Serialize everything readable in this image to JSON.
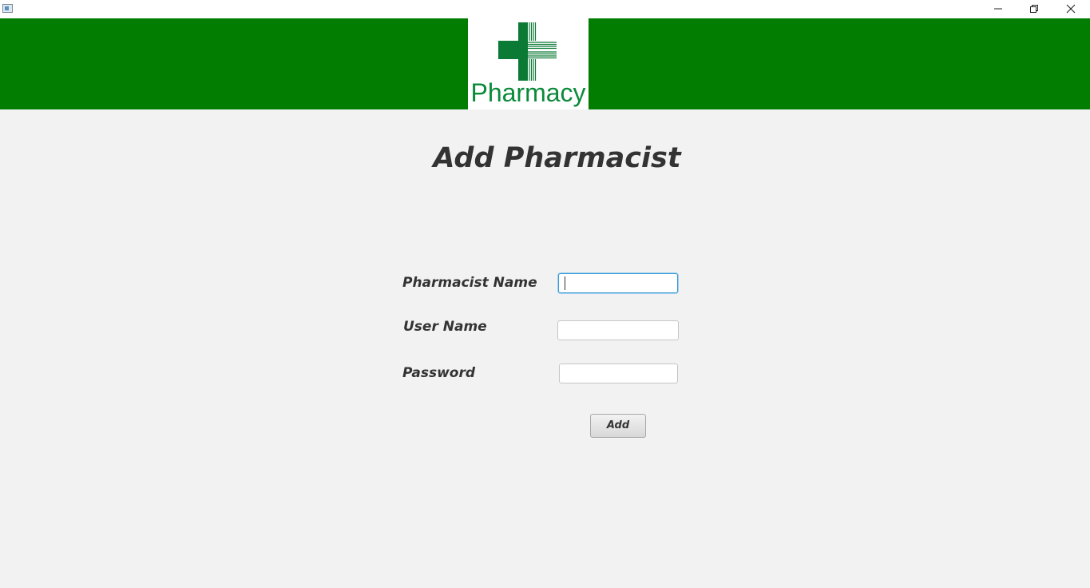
{
  "window": {
    "icons": [
      "app-icon",
      "minimize-icon",
      "restore-icon",
      "close-icon"
    ]
  },
  "header": {
    "background_color": "#027d02",
    "logo": {
      "text": "Pharmacy",
      "icon": "pharmacy-cross-icon",
      "color": "#0b8a3a"
    }
  },
  "form": {
    "title": "Add Pharmacist",
    "fields": [
      {
        "label": "Pharmacist Name",
        "value": "",
        "focused": true
      },
      {
        "label": "User Name",
        "value": ""
      },
      {
        "label": "Password",
        "value": ""
      }
    ],
    "submit_label": "Add"
  },
  "colors": {
    "background": "#f2f2f2",
    "text": "#333333",
    "focus_border": "#3c9ad6"
  }
}
